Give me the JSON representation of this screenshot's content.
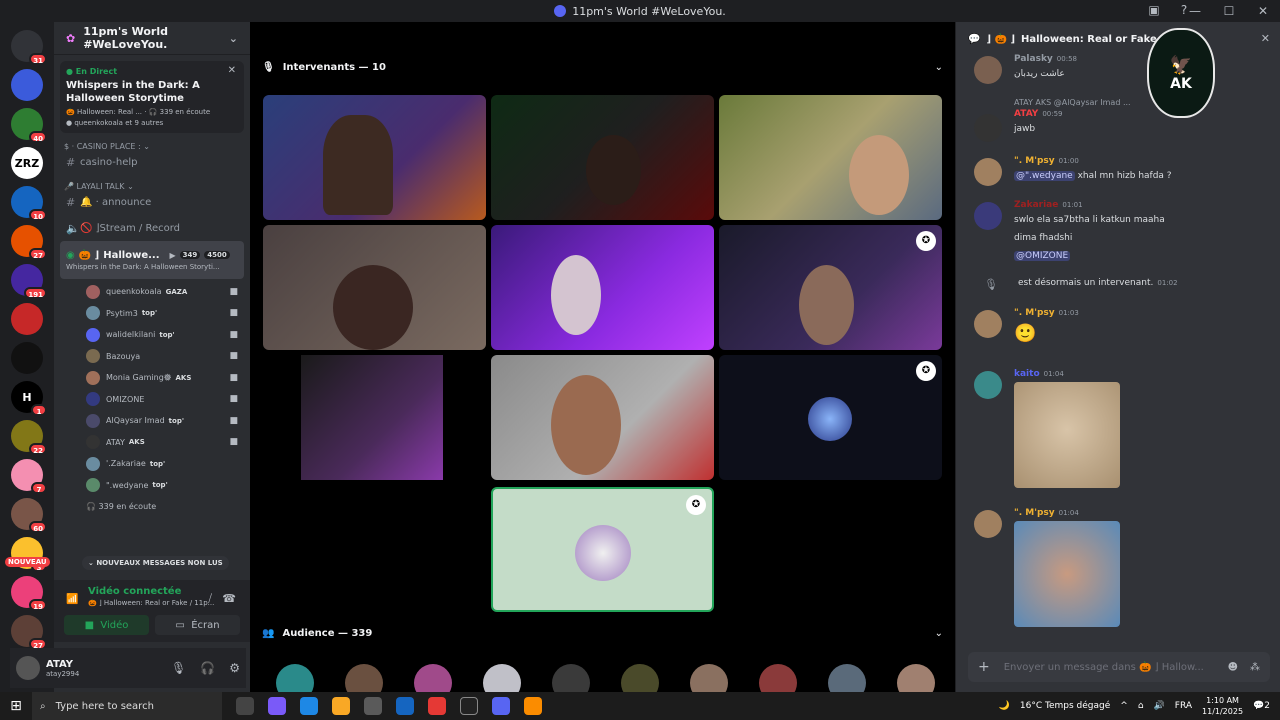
{
  "window": {
    "title": "11pm's World #WeLoveYou."
  },
  "guilds": [
    {
      "label": "",
      "badge": "31",
      "color": "#313338"
    },
    {
      "label": "",
      "badge": "",
      "color": "#3b5bdb"
    },
    {
      "label": "",
      "badge": "40",
      "color": "#2e7d32"
    },
    {
      "label": "ZRZ",
      "badge": "",
      "color": "#ffffff"
    },
    {
      "label": "",
      "badge": "10",
      "color": "#1565c0"
    },
    {
      "label": "",
      "badge": "27",
      "color": "#e65100"
    },
    {
      "label": "",
      "badge": "191",
      "color": "#4527a0"
    },
    {
      "label": "",
      "badge": "",
      "color": "#c62828"
    },
    {
      "label": "",
      "badge": "",
      "color": "#111111"
    },
    {
      "label": "H",
      "badge": "1",
      "color": "#000000"
    },
    {
      "label": "",
      "badge": "22",
      "color": "#827717"
    },
    {
      "label": "",
      "badge": "7",
      "color": "#f48fb1"
    },
    {
      "label": "",
      "badge": "60",
      "color": "#795548"
    },
    {
      "label": "",
      "badge": "3",
      "color": "#fbc02d"
    },
    {
      "label": "",
      "badge": "19",
      "color": "#ec407a"
    },
    {
      "label": "",
      "badge": "27",
      "color": "#5d4037"
    }
  ],
  "new_badge": "NOUVEAU",
  "server": {
    "name": "11pm's World #WeLoveYou."
  },
  "event": {
    "live": "En Direct",
    "title": "Whispers in the Dark: A Halloween Storytime",
    "meta_channel": "Halloween: Real ...",
    "meta_listening": "339 en écoute",
    "meta_people": "queenkokoala et 9 autres"
  },
  "categories": {
    "casino": "Casino Place :",
    "casino_help": "casino-help",
    "layali": "LAYALI TALK",
    "announce": "announce",
    "stream": "Stream / Record",
    "halloween": "Hallowe...",
    "halloween_count1": "349",
    "halloween_count2": "4500",
    "halloween_sub": "Whispers in the Dark: A Halloween Storyti..."
  },
  "members": [
    {
      "name": "queenkokoala",
      "tag": "GAZA",
      "cam": true,
      "color": "#a06060"
    },
    {
      "name": "Psytim3",
      "tag": "top'",
      "cam": true,
      "color": "#6a8ca0"
    },
    {
      "name": "walidelkilani",
      "tag": "top'",
      "cam": true,
      "color": "#5865f2"
    },
    {
      "name": "Bazouya",
      "tag": "",
      "cam": true,
      "color": "#7a6a50"
    },
    {
      "name": "Monia Gaming𖣔",
      "tag": "AKS",
      "cam": true,
      "color": "#a0705a"
    },
    {
      "name": "OMIZONE",
      "tag": "",
      "cam": true,
      "color": "#333a80"
    },
    {
      "name": "AlQaysar Imad",
      "tag": "top'",
      "cam": true,
      "color": "#4a4a6a"
    },
    {
      "name": "ATAY",
      "tag": "AKS",
      "cam": true,
      "color": "#333"
    },
    {
      "name": "'.Zakariae",
      "tag": "top'",
      "cam": false,
      "color": "#6a8ca0"
    },
    {
      "name": "\".wedyane",
      "tag": "top'",
      "cam": false,
      "color": "#5a8a6a"
    }
  ],
  "listening": "339 en écoute",
  "new_messages": "NOUVEAUX MESSAGES NON LUS",
  "rtc": {
    "title": "Vidéo connectée",
    "sub": "Halloween: Real or Fake / 11p...",
    "video": "Vidéo",
    "screen": "Écran"
  },
  "user": {
    "name": "ATAY",
    "tag": "atay2994"
  },
  "stage": {
    "speakers_label": "Intervenants — 10",
    "audience_label": "Audience — 339"
  },
  "chat": {
    "title": "Halloween: Real or Fake",
    "messages": [
      {
        "name": "Palasky",
        "time": "00:58",
        "text": "عاشت ريدبان",
        "color": "#949ba4"
      },
      {
        "name": "ATAY",
        "time": "00:59",
        "text": "jawb",
        "reply": "ATAY  AKS  @AlQaysar Imad ...",
        "color": "#f23f43"
      },
      {
        "name": "\". M'psy",
        "time": "01:00",
        "mention": "@\".wedyane",
        "text": "xhal mn hizb hafda ?",
        "color": "#f0b232"
      },
      {
        "name": "Zakariae",
        "time": "01:01",
        "text": "swlo ela sa7btha li katkun maaha",
        "text2": "dima fhadshi",
        "mention": "@OMIZONE",
        "color": "#a02020"
      },
      {
        "name": "",
        "time": "01:02",
        "text": "est désormais un intervenant.",
        "color": "#a02020"
      },
      {
        "name": "\". M'psy",
        "time": "01:03",
        "text": "🙂",
        "color": "#f0b232"
      },
      {
        "name": "kaito",
        "time": "01:04",
        "text": "",
        "color": "#5865f2"
      },
      {
        "name": "\". M'psy",
        "time": "01:04",
        "text": "",
        "color": "#f0b232"
      }
    ],
    "placeholder": "Envoyer un message dans",
    "placeholder_channel": "Hallow..."
  },
  "taskbar": {
    "search": "Type here to search",
    "weather": "16°C  Temps dégagé",
    "lang": "FRA",
    "time": "1:10 AM",
    "date": "11/1/2025",
    "notifications": "2"
  }
}
